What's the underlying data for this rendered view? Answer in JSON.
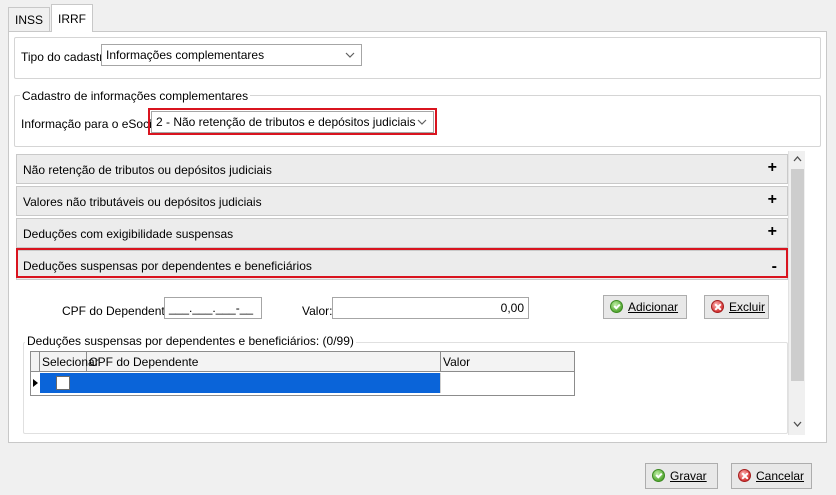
{
  "tabs": [
    {
      "label": "INSS",
      "active": false
    },
    {
      "label": "IRRF",
      "active": true
    }
  ],
  "tipo_cadastro": {
    "label": "Tipo do cadastro:",
    "value": "Informações complementares"
  },
  "cadastro_group": {
    "title": "Cadastro de informações complementares",
    "esocial_label": "Informação para o eSocial:",
    "esocial_value": "2 - Não retenção de tributos e depósitos judiciais"
  },
  "accordion": [
    {
      "label": "Não retenção de tributos ou depósitos judiciais",
      "sign": "+"
    },
    {
      "label": "Valores não tributáveis ou depósitos judiciais",
      "sign": "+"
    },
    {
      "label": "Deduções com exigibilidade suspensas",
      "sign": "+"
    },
    {
      "label": "Deduções suspensas por dependentes e beneficiários",
      "sign": "-"
    }
  ],
  "form": {
    "cpf_label": "CPF do Dependente:",
    "cpf_value": "___.___.___-__",
    "valor_label": "Valor:",
    "valor_value": "0,00",
    "add_button": "Adicionar",
    "delete_button": "Excluir"
  },
  "grid_group": {
    "title": "Deduções suspensas por dependentes e beneficiários: (0/99)",
    "columns": [
      "Selecionar",
      "CPF do Dependente",
      "Valor"
    ]
  },
  "footer": {
    "save_button": "Gravar",
    "cancel_button": "Cancelar"
  },
  "colors": {
    "highlight_border": "#d9141f",
    "selection_blue": "#0a64d9"
  }
}
